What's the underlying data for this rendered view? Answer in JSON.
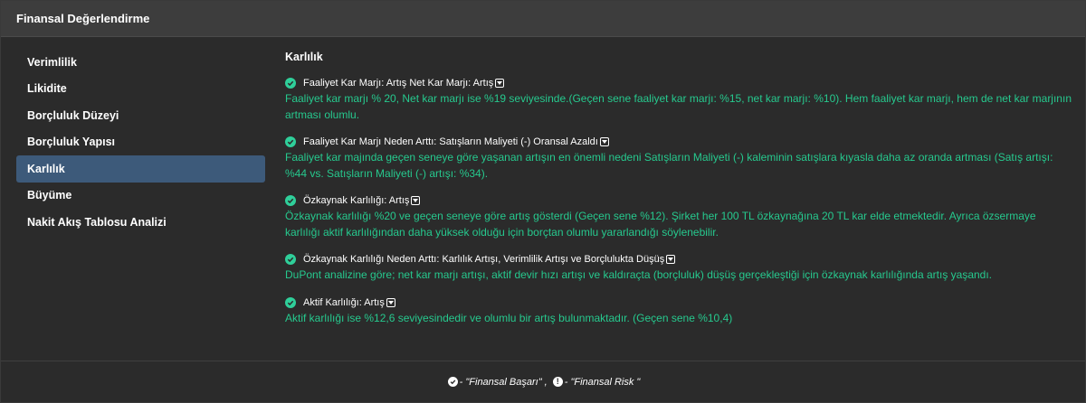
{
  "panel": {
    "title": "Finansal Değerlendirme"
  },
  "sidebar": {
    "items": [
      {
        "label": "Verimlilik"
      },
      {
        "label": "Likidite"
      },
      {
        "label": "Borçluluk Düzeyi"
      },
      {
        "label": "Borçluluk Yapısı"
      },
      {
        "label": "Karlılık",
        "active": true
      },
      {
        "label": "Büyüme"
      },
      {
        "label": "Nakit Akış Tablosu Analizi"
      }
    ]
  },
  "content": {
    "title": "Karlılık",
    "items": [
      {
        "head": "Faaliyet Kar Marjı: Artış Net Kar Marjı: Artış",
        "text": "Faaliyet kar marjı % 20, Net kar marjı ise %19 seviyesinde.(Geçen sene faaliyet kar marjı: %15, net kar marjı: %10). Hem faaliyet kar marjı, hem de net kar marjının artması olumlu."
      },
      {
        "head": "Faaliyet Kar Marjı Neden Arttı: Satışların Maliyeti (-) Oransal Azaldı",
        "text": "Faaliyet kar majında geçen seneye göre yaşanan artışın en önemli nedeni Satışların Maliyeti (-) kaleminin satışlara kıyasla daha az oranda artması (Satış artışı: %44 vs. Satışların Maliyeti (-) artışı: %34)."
      },
      {
        "head": "Özkaynak Karlılığı: Artış",
        "text": "Özkaynak karlılığı %20 ve geçen seneye göre artış gösterdi (Geçen sene %12). Şirket her 100 TL özkaynağına 20 TL kar elde etmektedir. Ayrıca özsermaye karlılığı aktif karlılığından daha yüksek olduğu için borçtan olumlu yararlandığı söylenebilir."
      },
      {
        "head": "Özkaynak Karlılığı Neden Arttı: Karlılık Artışı, Verimlilik Artışı ve Borçlulukta Düşüş",
        "text": "DuPont analizine göre; net kar marjı artışı, aktif devir hızı artışı ve kaldıraçta (borçluluk) düşüş gerçekleştiği için özkaynak karlılığında artış yaşandı."
      },
      {
        "head": "Aktif Karlılığı: Artış",
        "text": "Aktif karlılığı ise %12,6 seviyesindedir ve olumlu bir artış bulunmaktadır. (Geçen sene %10,4)"
      }
    ]
  },
  "footer": {
    "success_label": "- \"Finansal Başarı\" ,",
    "risk_label": "- \"Finansal Risk \""
  },
  "colors": {
    "accent_green": "#26c98e",
    "active_item": "#3d5a7a",
    "background": "#2b2b2b",
    "header": "#3d3d3d"
  },
  "icons": {
    "item": "check-circle-icon",
    "toggle": "caret-down-box-icon",
    "risk": "exclamation-circle-icon"
  }
}
